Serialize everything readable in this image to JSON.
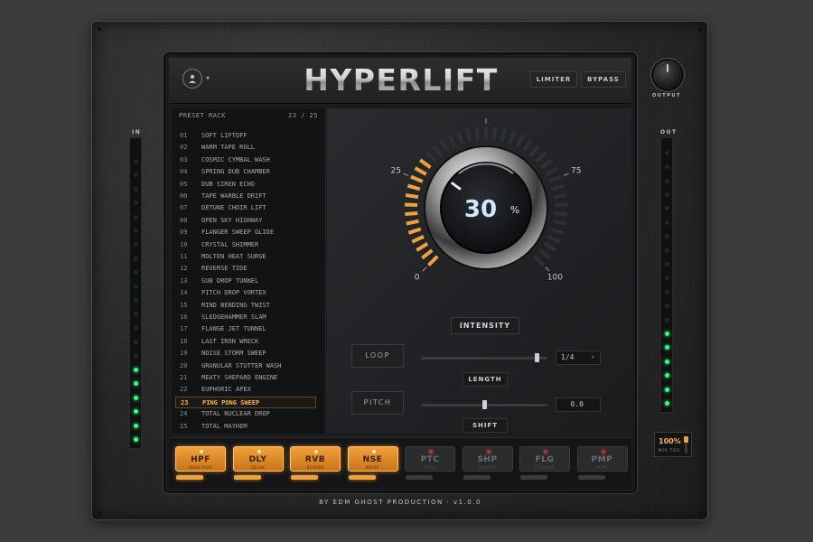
{
  "app": {
    "title": "HYPERLIFT"
  },
  "header": {
    "limiter_label": "LIMITER",
    "bypass_label": "BYPASS",
    "output_label": "OUTPUT"
  },
  "meters": {
    "in_label": "IN",
    "out_label": "OUT",
    "in_level": 0.3,
    "out_level": 0.3
  },
  "rack": {
    "title": "PRESET RACK",
    "count": "23 / 25",
    "presets": [
      {
        "num": "01",
        "name": "SOFT LIFTOFF"
      },
      {
        "num": "02",
        "name": "WARM TAPE ROLL"
      },
      {
        "num": "03",
        "name": "COSMIC CYMBAL WASH"
      },
      {
        "num": "04",
        "name": "SPRING DUB CHAMBER"
      },
      {
        "num": "05",
        "name": "DUB SIREN ECHO"
      },
      {
        "num": "06",
        "name": "TAPE WARBLE DRIFT"
      },
      {
        "num": "07",
        "name": "DETUNE CHOIR LIFT"
      },
      {
        "num": "08",
        "name": "OPEN SKY HIGHWAY"
      },
      {
        "num": "09",
        "name": "FLANGER SWEEP GLIDE"
      },
      {
        "num": "10",
        "name": "CRYSTAL SHIMMER"
      },
      {
        "num": "11",
        "name": "MOLTEN HEAT SURGE"
      },
      {
        "num": "12",
        "name": "REVERSE TIDE"
      },
      {
        "num": "13",
        "name": "SUB DROP TUNNEL"
      },
      {
        "num": "14",
        "name": "PITCH DROP VORTEX"
      },
      {
        "num": "15",
        "name": "MIND BENDING TWIST"
      },
      {
        "num": "16",
        "name": "SLEDGEHAMMER SLAM"
      },
      {
        "num": "17",
        "name": "FLANGE JET TUNNEL"
      },
      {
        "num": "18",
        "name": "LAST IRON WRECK"
      },
      {
        "num": "19",
        "name": "NOISE STORM SWEEP"
      },
      {
        "num": "20",
        "name": "GRANULAR STUTTER WASH"
      },
      {
        "num": "21",
        "name": "MEATY SHEPARD ENGINE"
      },
      {
        "num": "22",
        "name": "EUPHORIC APEX"
      },
      {
        "num": "23",
        "name": "PING PONG SWEEP"
      },
      {
        "num": "24",
        "name": "TOTAL NUCLEAR DROP"
      },
      {
        "num": "25",
        "name": "TOTAL MAYHEM"
      }
    ],
    "active_index": 22
  },
  "dial": {
    "value": "30",
    "unit": "%",
    "level": 0.3,
    "ticks": [
      "0",
      "25",
      "50",
      "75",
      "100"
    ],
    "label": "INTENSITY"
  },
  "controls": {
    "loop_label": "LOOP",
    "loop_slider": 0.92,
    "loop_value": "1/4",
    "length_label": "LENGTH",
    "pitch_label": "PITCH",
    "pitch_slider": 0.5,
    "pitch_value": "0.0",
    "shift_label": "SHIFT"
  },
  "fx": [
    {
      "code": "HPF",
      "sub": "HIGH PASS",
      "on": true
    },
    {
      "code": "DLY",
      "sub": "DELAY",
      "on": true
    },
    {
      "code": "RVB",
      "sub": "REVERB",
      "on": true
    },
    {
      "code": "NSE",
      "sub": "NOISE",
      "on": true
    },
    {
      "code": "PTC",
      "sub": "PITCH",
      "on": false
    },
    {
      "code": "SHP",
      "sub": "SHAPER",
      "on": false
    },
    {
      "code": "FLG",
      "sub": "FLANGER",
      "on": false
    },
    {
      "code": "PMP",
      "sub": "PUMP",
      "on": false
    }
  ],
  "mix": {
    "value": "100%",
    "label": "MIX TOG"
  },
  "footer": {
    "text": "BY EDM GHOST PRODUCTION · v1.0.0"
  },
  "colors": {
    "accent": "#f0a23a",
    "led_green": "#2dff8a",
    "led_red": "#e0443a",
    "dial_blue": "#cfe8ff"
  }
}
